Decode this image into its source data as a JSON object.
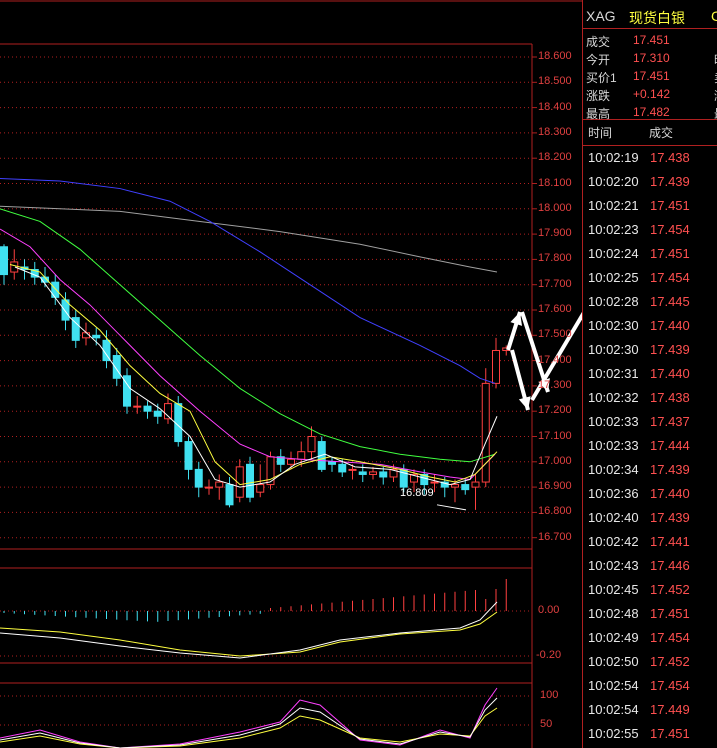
{
  "chart": {
    "price_axis": [
      "18.600",
      "18.500",
      "18.400",
      "18.300",
      "18.200",
      "18.100",
      "18.000",
      "17.900",
      "17.800",
      "17.700",
      "17.600",
      "17.500",
      "17.400",
      "17.300",
      "17.200",
      "17.100",
      "17.000",
      "16.900",
      "16.800",
      "16.700"
    ],
    "macd_axis": [
      "0.00",
      "-0.20"
    ],
    "kdj_axis": [
      "100",
      "50"
    ],
    "lowest_label": "16.809",
    "colors": {
      "grid": "#b02020",
      "candle_up": "#ff4040",
      "candle_down": "#40e0f0",
      "ma5": "#ffffff",
      "ma10": "#ffff40",
      "ma20": "#ff40ff",
      "ma30": "#40ff40",
      "ma60": "#4040ff",
      "ma120": "#a0a0a0"
    }
  },
  "panel": {
    "symbol": "XAG",
    "name": "现货白银",
    "more": "C",
    "quotes": [
      {
        "label": "成交",
        "value": "17.451",
        "extra": ""
      },
      {
        "label": "今开",
        "value": "17.310",
        "extra": "昨"
      },
      {
        "label": "买价1",
        "value": "17.451",
        "extra": "卖"
      },
      {
        "label": "涨跌",
        "value": "+0.142",
        "extra": "涨"
      },
      {
        "label": "最高",
        "value": "17.482",
        "extra": "最"
      }
    ],
    "tick_headers": {
      "time": "时间",
      "price": "成交"
    },
    "ticks": [
      {
        "time": "10:02:19",
        "price": "17.438"
      },
      {
        "time": "10:02:20",
        "price": "17.439"
      },
      {
        "time": "10:02:21",
        "price": "17.451"
      },
      {
        "time": "10:02:23",
        "price": "17.454"
      },
      {
        "time": "10:02:24",
        "price": "17.451"
      },
      {
        "time": "10:02:25",
        "price": "17.454"
      },
      {
        "time": "10:02:28",
        "price": "17.445"
      },
      {
        "time": "10:02:30",
        "price": "17.440"
      },
      {
        "time": "10:02:30",
        "price": "17.439"
      },
      {
        "time": "10:02:31",
        "price": "17.440"
      },
      {
        "time": "10:02:32",
        "price": "17.438"
      },
      {
        "time": "10:02:33",
        "price": "17.437"
      },
      {
        "time": "10:02:33",
        "price": "17.444"
      },
      {
        "time": "10:02:34",
        "price": "17.439"
      },
      {
        "time": "10:02:36",
        "price": "17.440"
      },
      {
        "time": "10:02:40",
        "price": "17.439"
      },
      {
        "time": "10:02:42",
        "price": "17.441"
      },
      {
        "time": "10:02:43",
        "price": "17.446"
      },
      {
        "time": "10:02:45",
        "price": "17.452"
      },
      {
        "time": "10:02:48",
        "price": "17.451"
      },
      {
        "time": "10:02:49",
        "price": "17.454"
      },
      {
        "time": "10:02:50",
        "price": "17.452"
      },
      {
        "time": "10:02:54",
        "price": "17.454"
      },
      {
        "time": "10:02:54",
        "price": "17.449"
      },
      {
        "time": "10:02:55",
        "price": "17.451"
      }
    ]
  }
}
